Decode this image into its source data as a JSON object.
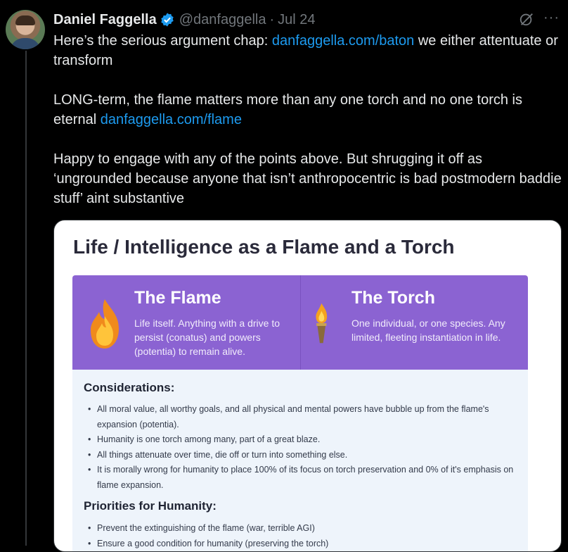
{
  "tweet": {
    "author_name": "Daniel Faggella",
    "handle": "@danfaggella",
    "separator": "·",
    "date": "Jul 24",
    "more_label": "···",
    "p1_text": "Here’s the serious argument chap: ",
    "p1_link": "danfaggella.com/baton",
    "p1_after": " we either attentuate or transform",
    "p2_text": "LONG-term, the flame matters more than any one torch and no one torch is eternal ",
    "p2_link": "danfaggella.com/flame",
    "p3_text": "Happy to engage with any of the points above. But shrugging it off as ‘ungrounded because anyone that isn’t anthropocentric is bad postmodern baddie stuff’ aint substantive"
  },
  "card": {
    "title": "Life / Intelligence as a Flame and a Torch",
    "flame": {
      "title": "The Flame",
      "desc": "Life itself. Anything with a drive to persist (conatus) and powers (potentia) to remain alive.",
      "icon": "flame-icon"
    },
    "torch": {
      "title": "The Torch",
      "desc": "One individual, or one species. Any limited, fleeting instantiation in life.",
      "icon": "torch-icon"
    },
    "considerations_heading": "Considerations:",
    "considerations": [
      "All moral value, all worthy goals, and all physical and mental powers have bubble up from the flame's expansion (potentia).",
      "Humanity is one torch among many, part of a great blaze.",
      "All things attenuate over time, die off or turn into something else.",
      "It is morally wrong for humanity to place 100% of its focus on torch preservation and 0% of it's emphasis on flame expansion."
    ],
    "priorities_heading": "Priorities for Humanity:",
    "priorities": [
      "Prevent the extinguishing of the flame (war, terrible AGI)",
      "Ensure a good condition for humanity (preserving the torch)"
    ]
  },
  "colors": {
    "background": "#000000",
    "link": "#1d9bf0",
    "muted": "#71767b",
    "verified": "#1d9bf0",
    "card_purple": "#8b63d2"
  }
}
